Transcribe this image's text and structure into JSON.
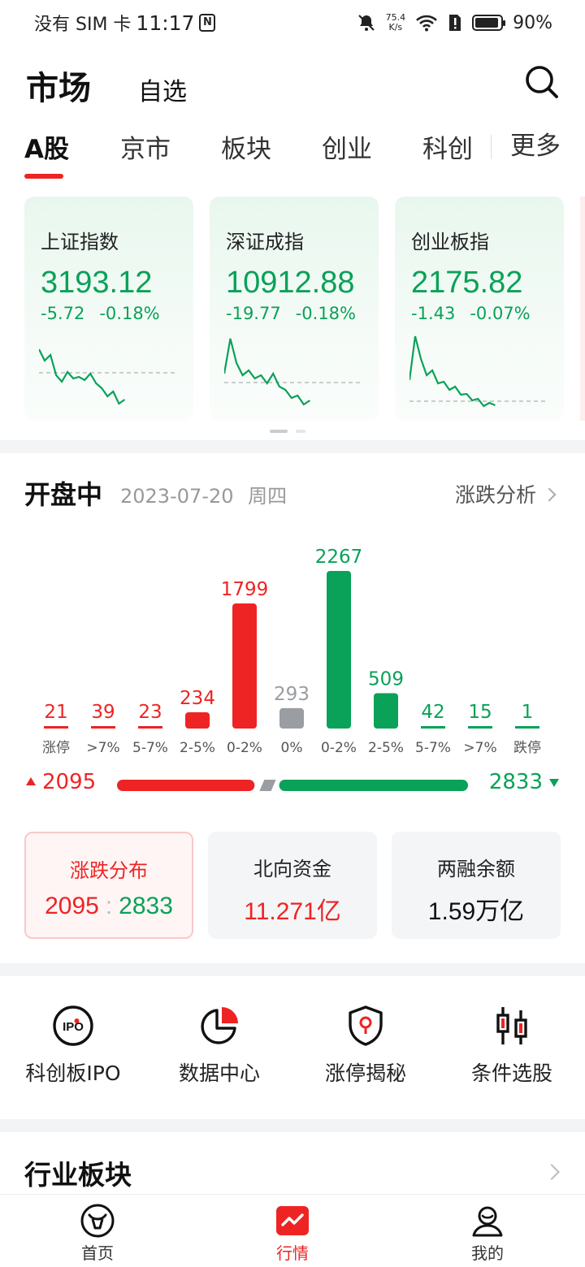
{
  "status_bar": {
    "carrier": "没有 SIM 卡",
    "time": "11:17",
    "speed_value": "75.4",
    "speed_unit": "K/s",
    "battery": "90%"
  },
  "header": {
    "title": "市场",
    "watchlist": "自选"
  },
  "tabs": [
    {
      "label": "A股",
      "active": true
    },
    {
      "label": "京市"
    },
    {
      "label": "板块"
    },
    {
      "label": "创业"
    },
    {
      "label": "科创"
    },
    {
      "label": "更多"
    }
  ],
  "indices": [
    {
      "name": "上证指数",
      "value": "3193.12",
      "change": "-5.72",
      "change_pct": "-0.18%",
      "spark": [
        0.72,
        0.58,
        0.65,
        0.4,
        0.32,
        0.44,
        0.36,
        0.38,
        0.34,
        0.42,
        0.3,
        0.24,
        0.14,
        0.2,
        0.05,
        0.1
      ],
      "spark_ref": 0.43
    },
    {
      "name": "深证成指",
      "value": "10912.88",
      "change": "-19.77",
      "change_pct": "-0.18%",
      "spark": [
        0.42,
        0.85,
        0.55,
        0.4,
        0.46,
        0.36,
        0.4,
        0.3,
        0.42,
        0.26,
        0.22,
        0.12,
        0.15,
        0.04,
        0.09
      ],
      "spark_ref": 0.31
    },
    {
      "name": "创业板指",
      "value": "2175.82",
      "change": "-1.43",
      "change_pct": "-0.07%",
      "spark": [
        0.34,
        0.88,
        0.6,
        0.4,
        0.46,
        0.3,
        0.32,
        0.22,
        0.26,
        0.16,
        0.17,
        0.09,
        0.11,
        0.02,
        0.06,
        0.03
      ],
      "spark_ref": 0.08
    }
  ],
  "market": {
    "status": "开盘中",
    "date": "2023-07-20",
    "weekday": "周四",
    "analysis_link": "涨跌分析"
  },
  "chart_data": {
    "type": "bar",
    "categories": [
      "涨停",
      ">7%",
      "5-7%",
      "2-5%",
      "0-2%",
      "0%",
      "0-2%",
      "2-5%",
      "5-7%",
      ">7%",
      "跌停"
    ],
    "values": [
      21,
      39,
      23,
      234,
      1799,
      293,
      2267,
      509,
      42,
      15,
      1
    ],
    "colors": [
      "#ee2424",
      "#ee2424",
      "#ee2424",
      "#ee2424",
      "#ee2424",
      "#9a9da2",
      "#0aa158",
      "#0aa158",
      "#0aa158",
      "#0aa158",
      "#0aa158"
    ],
    "ylim": [
      0,
      2267
    ]
  },
  "ratio": {
    "up": "2095",
    "down": "2833",
    "up_count": 2095,
    "flat_count": 293,
    "down_count": 2833
  },
  "stats": [
    {
      "label": "涨跌分布",
      "up": "2095",
      "down": "2833"
    },
    {
      "label": "北向资金",
      "value": "11.271亿"
    },
    {
      "label": "两融余额",
      "value": "1.59万亿"
    }
  ],
  "shortcuts": [
    {
      "label": "科创板IPO",
      "icon": "ipo-icon"
    },
    {
      "label": "数据中心",
      "icon": "pie-chart-icon"
    },
    {
      "label": "涨停揭秘",
      "icon": "shield-pin-icon"
    },
    {
      "label": "条件选股",
      "icon": "candlestick-icon"
    }
  ],
  "industry_section": {
    "title": "行业板块"
  },
  "bottom_nav": [
    {
      "label": "首页",
      "icon": "bull-icon"
    },
    {
      "label": "行情",
      "icon": "market-chart-icon",
      "active": true
    },
    {
      "label": "我的",
      "icon": "profile-icon"
    }
  ],
  "colors": {
    "up": "#ee2424",
    "down": "#0aa158",
    "flat": "#9a9da2"
  }
}
